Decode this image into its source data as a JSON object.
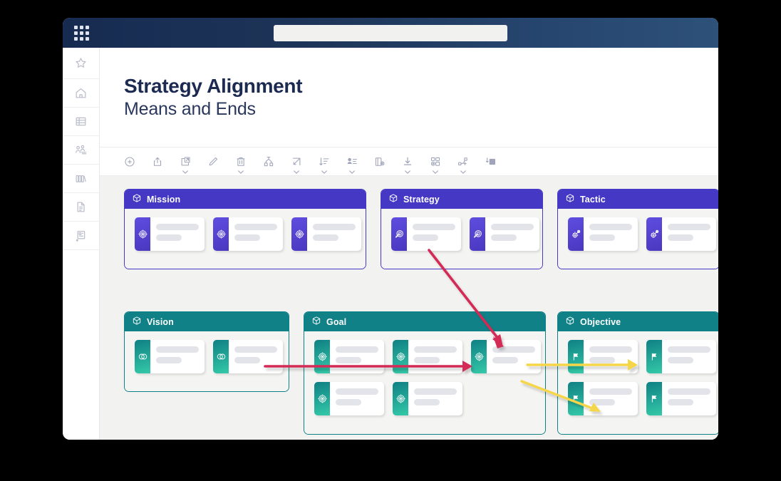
{
  "window": {
    "topbar": {
      "apps_icon": "grid-dots-icon",
      "omnibox_value": "",
      "omnibox_placeholder": ""
    }
  },
  "sidebar": {
    "items": [
      {
        "name": "favorites",
        "icon": "star-icon"
      },
      {
        "name": "home",
        "icon": "home-icon"
      },
      {
        "name": "tables",
        "icon": "table-icon"
      },
      {
        "name": "people",
        "icon": "people-list-icon"
      },
      {
        "name": "library",
        "icon": "books-icon"
      },
      {
        "name": "documents",
        "icon": "document-icon"
      },
      {
        "name": "reports",
        "icon": "card-arrow-icon"
      }
    ]
  },
  "page": {
    "title": "Strategy Alignment",
    "subtitle": "Means and Ends"
  },
  "toolbar": {
    "items": [
      {
        "name": "add",
        "icon": "plus-circle-icon",
        "caret": false
      },
      {
        "name": "share",
        "icon": "upload-box-icon",
        "caret": false
      },
      {
        "name": "open-external",
        "icon": "open-external-icon",
        "caret": true
      },
      {
        "name": "edit",
        "icon": "pencil-icon",
        "caret": false
      },
      {
        "name": "delete",
        "icon": "trash-icon",
        "caret": true
      },
      {
        "name": "hierarchy",
        "icon": "org-tree-icon",
        "caret": false
      },
      {
        "name": "expand",
        "icon": "expand-arrow-icon",
        "caret": true
      },
      {
        "name": "sort",
        "icon": "sort-descending-icon",
        "caret": true
      },
      {
        "name": "assign-user",
        "icon": "user-list-icon",
        "caret": true
      },
      {
        "name": "layout-settings",
        "icon": "panel-gear-icon",
        "caret": false
      },
      {
        "name": "download",
        "icon": "download-icon",
        "caret": true
      },
      {
        "name": "components",
        "icon": "shapes-gear-icon",
        "caret": true
      },
      {
        "name": "add-connection",
        "icon": "connection-plus-icon",
        "caret": true
      },
      {
        "name": "insert-image",
        "icon": "image-import-icon",
        "caret": false
      }
    ]
  },
  "colors": {
    "purple": "#4438c4",
    "purple_card_from": "#5f4de0",
    "purple_card_to": "#4a38c0",
    "teal": "#108287",
    "teal_card_from": "#0f8084",
    "teal_card_to": "#34c9a8",
    "navy": "#172b51",
    "arrow_crimson": "#d42a57",
    "arrow_yellow": "#f6d64a",
    "canvas_bg": "#f2f2f0",
    "placeholder_bar": "#e3e4ea"
  },
  "board": {
    "groups": [
      {
        "id": "mission",
        "label": "Mission",
        "theme": "purple",
        "group_icon": "cube-icon",
        "card_icon": "target-icon",
        "cards": 3
      },
      {
        "id": "strategy",
        "label": "Strategy",
        "theme": "purple",
        "group_icon": "cube-icon",
        "card_icon": "dart-target-icon",
        "cards": 2
      },
      {
        "id": "tactic",
        "label": "Tactic",
        "theme": "purple",
        "group_icon": "cube-icon",
        "card_icon": "gear-wrench-icon",
        "cards": 2
      },
      {
        "id": "vision",
        "label": "Vision",
        "theme": "teal",
        "group_icon": "cube-icon",
        "card_icon": "binocular-rings-icon",
        "cards": 2
      },
      {
        "id": "goal",
        "label": "Goal",
        "theme": "teal",
        "group_icon": "cube-icon",
        "card_icon": "target-icon",
        "cards": 5
      },
      {
        "id": "objective",
        "label": "Objective",
        "theme": "teal",
        "group_icon": "cube-icon",
        "card_icon": "flag-icon",
        "cards": 4
      }
    ],
    "connections": [
      {
        "name": "strategy-to-goal",
        "color": "#d42a57",
        "style": "diagonal-down-right"
      },
      {
        "name": "vision-to-goal",
        "color": "#d42a57",
        "style": "horizontal-right"
      },
      {
        "name": "goal-to-objective-top",
        "color": "#f6d64a",
        "style": "horizontal-right"
      },
      {
        "name": "goal-to-objective-bottom",
        "color": "#f6d64a",
        "style": "diagonal-down-right"
      }
    ]
  }
}
